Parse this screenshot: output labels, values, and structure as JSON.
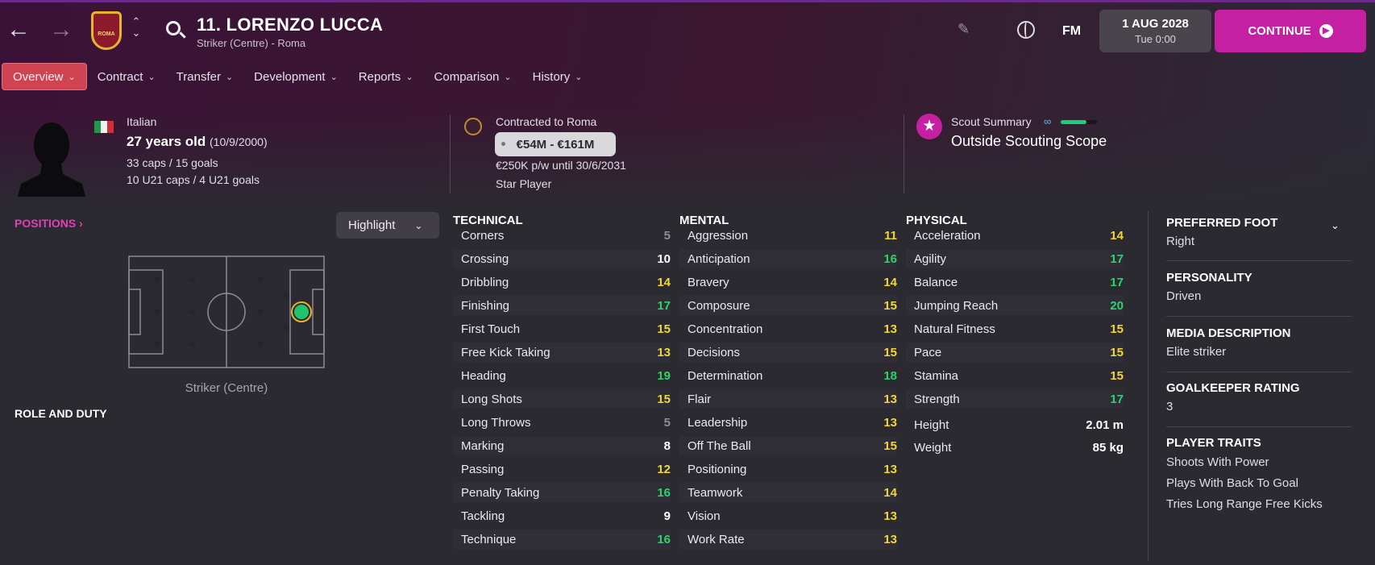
{
  "header": {
    "player_name": "11. LORENZO LUCCA",
    "player_subtitle": "Striker (Centre) - Roma",
    "club_badge_text": "ROMA",
    "date": "1 AUG 2028",
    "time": "Tue 0:00",
    "continue_label": "CONTINUE",
    "fm_label": "FM"
  },
  "tabs": [
    {
      "label": "Overview"
    },
    {
      "label": "Contract"
    },
    {
      "label": "Transfer"
    },
    {
      "label": "Development"
    },
    {
      "label": "Reports"
    },
    {
      "label": "Comparison"
    },
    {
      "label": "History"
    }
  ],
  "info": {
    "nationality": "Italian",
    "age": "27 years old",
    "dob": "(10/9/2000)",
    "caps": "33 caps / 15 goals",
    "u21": "10 U21 caps / 4 U21 goals",
    "contracted": "Contracted to Roma",
    "value_range": "€54M - €161M",
    "wage": "€250K p/w until 30/6/2031",
    "status": "Star Player",
    "scout_label": "Scout Summary",
    "scout_value": "Outside Scouting Scope",
    "scout_bar_fraction": 0.72
  },
  "positions": {
    "title": "POSITIONS",
    "highlight_label": "Highlight",
    "position_label": "Striker (Centre)",
    "role_title": "ROLE AND DUTY"
  },
  "attributes": {
    "technical": {
      "title": "TECHNICAL",
      "rows": [
        {
          "name": "Corners",
          "value": "5"
        },
        {
          "name": "Crossing",
          "value": "10"
        },
        {
          "name": "Dribbling",
          "value": "14"
        },
        {
          "name": "Finishing",
          "value": "17"
        },
        {
          "name": "First Touch",
          "value": "15"
        },
        {
          "name": "Free Kick Taking",
          "value": "13"
        },
        {
          "name": "Heading",
          "value": "19"
        },
        {
          "name": "Long Shots",
          "value": "15"
        },
        {
          "name": "Long Throws",
          "value": "5"
        },
        {
          "name": "Marking",
          "value": "8"
        },
        {
          "name": "Passing",
          "value": "12"
        },
        {
          "name": "Penalty Taking",
          "value": "16"
        },
        {
          "name": "Tackling",
          "value": "9"
        },
        {
          "name": "Technique",
          "value": "16"
        }
      ]
    },
    "mental": {
      "title": "MENTAL",
      "rows": [
        {
          "name": "Aggression",
          "value": "11"
        },
        {
          "name": "Anticipation",
          "value": "16"
        },
        {
          "name": "Bravery",
          "value": "14"
        },
        {
          "name": "Composure",
          "value": "15"
        },
        {
          "name": "Concentration",
          "value": "13"
        },
        {
          "name": "Decisions",
          "value": "15"
        },
        {
          "name": "Determination",
          "value": "18"
        },
        {
          "name": "Flair",
          "value": "13"
        },
        {
          "name": "Leadership",
          "value": "13"
        },
        {
          "name": "Off The Ball",
          "value": "15"
        },
        {
          "name": "Positioning",
          "value": "13"
        },
        {
          "name": "Teamwork",
          "value": "14"
        },
        {
          "name": "Vision",
          "value": "13"
        },
        {
          "name": "Work Rate",
          "value": "13"
        }
      ]
    },
    "physical": {
      "title": "PHYSICAL",
      "rows": [
        {
          "name": "Acceleration",
          "value": "14"
        },
        {
          "name": "Agility",
          "value": "17"
        },
        {
          "name": "Balance",
          "value": "17"
        },
        {
          "name": "Jumping Reach",
          "value": "20"
        },
        {
          "name": "Natural Fitness",
          "value": "15"
        },
        {
          "name": "Pace",
          "value": "15"
        },
        {
          "name": "Stamina",
          "value": "15"
        },
        {
          "name": "Strength",
          "value": "17"
        }
      ],
      "extra": [
        {
          "name": "Height",
          "value": "2.01 m"
        },
        {
          "name": "Weight",
          "value": "85 kg"
        }
      ]
    }
  },
  "side_panel": {
    "preferred_foot_title": "PREFERRED FOOT",
    "preferred_foot": "Right",
    "personality_title": "PERSONALITY",
    "personality": "Driven",
    "media_title": "MEDIA DESCRIPTION",
    "media": "Elite striker",
    "gk_title": "GOALKEEPER RATING",
    "gk": "3",
    "traits_title": "PLAYER TRAITS",
    "traits": [
      "Shoots With Power",
      "Plays With Back To Goal",
      "Tries Long Range Free Kicks"
    ]
  },
  "colors": {
    "accent": "#c51fa2",
    "tab_active": "#d04452",
    "value_low": "#8f8b93",
    "value_mid": "#ffffff",
    "value_good": "#f2d63a",
    "value_great": "#2fd36a"
  }
}
